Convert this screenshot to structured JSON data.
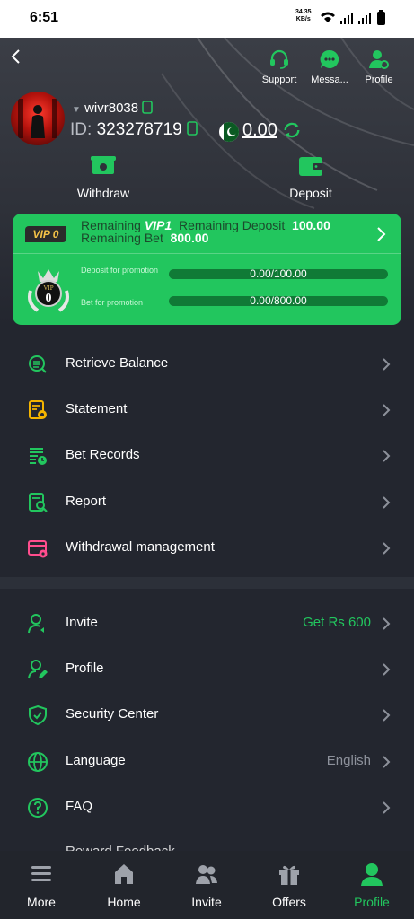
{
  "status_bar": {
    "time": "6:51",
    "net_speed": "34.35",
    "net_unit": "KB/s"
  },
  "top_actions": {
    "support": "Support",
    "messages": "Messa...",
    "profile": "Profile"
  },
  "user": {
    "username": "wivr8038",
    "id_label": "ID",
    "id_sep": ":",
    "id": "323278719",
    "balance": "0.00"
  },
  "actions": {
    "withdraw": "Withdraw",
    "deposit": "Deposit"
  },
  "vip": {
    "badge": "VIP 0",
    "remaining_label": "Remaining",
    "next_level": "VIP1",
    "deposit_label": "Remaining Deposit",
    "deposit_value": "100.00",
    "bet_label": "Remaining Bet",
    "bet_value": "800.00",
    "medal_text": "VIP",
    "medal_level": "0",
    "deposit_progress_label": "Deposit for promotion",
    "deposit_progress": "0.00/100.00",
    "bet_progress_label": "Bet for promotion",
    "bet_progress": "0.00/800.00"
  },
  "menu_primary": [
    "Retrieve Balance",
    "Statement",
    "Bet Records",
    "Report",
    "Withdrawal management"
  ],
  "menu_secondary": {
    "invite": "Invite",
    "invite_value": "Get Rs 600",
    "profile": "Profile",
    "security": "Security Center",
    "language": "Language",
    "language_value": "English",
    "faq": "FAQ",
    "partial": "Reward Feedback"
  },
  "bottom_nav": {
    "more": "More",
    "home": "Home",
    "invite": "Invite",
    "offers": "Offers",
    "profile": "Profile"
  },
  "colors": {
    "accent": "#22c65e",
    "background": "#23262f",
    "vip_gold": "#f4c247"
  }
}
